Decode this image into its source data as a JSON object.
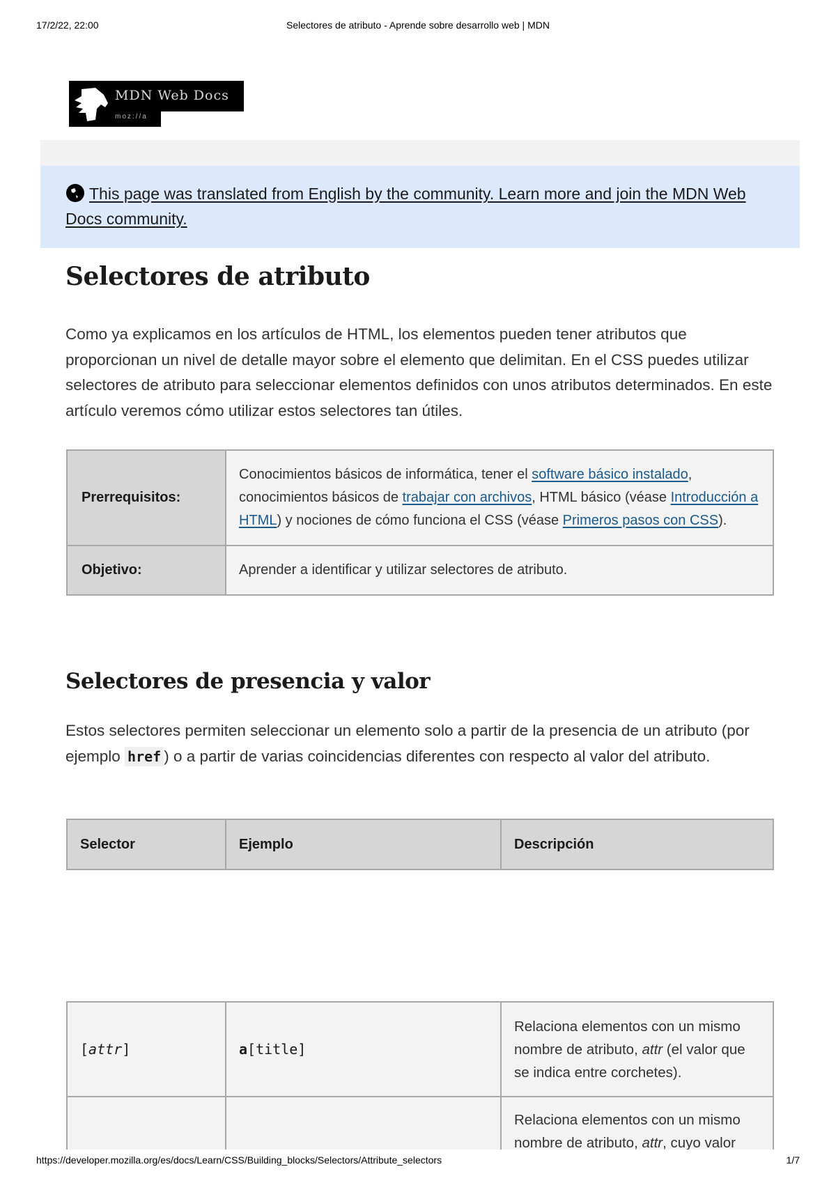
{
  "print_header": {
    "date": "17/2/22, 22:00",
    "title": "Selectores de atributo - Aprende sobre desarrollo web | MDN"
  },
  "logo": {
    "text": "MDN Web Docs",
    "sub": "moz://a",
    "icon": "dinosaur-head-icon"
  },
  "notice": {
    "icon": "globe-icon",
    "link_text": "This page was translated from English by the community. Learn more and join the MDN Web Docs community."
  },
  "article": {
    "title": "Selectores de atributo",
    "intro": "Como ya explicamos en los artículos de HTML, los elementos pueden tener atributos que proporcionan un nivel de detalle mayor sobre el elemento que delimitan. En el CSS puedes utilizar selectores de atributo para seleccionar elementos definidos con unos atributos determinados. En este artículo veremos cómo utilizar estos selectores tan útiles.",
    "info_table": {
      "prereq_label": "Prerrequisitos:",
      "prereq_parts": {
        "t1": "Conocimientos básicos de informática, tener el ",
        "l1": "software básico instalado",
        "t2": ", conocimientos básicos de ",
        "l2": "trabajar con archivos",
        "t3": ", HTML básico (véase ",
        "l3": "Introducción a HTML",
        "t4": ") y nociones de cómo funciona el CSS (véase ",
        "l4": "Primeros pasos con CSS",
        "t5": ")."
      },
      "objective_label": "Objetivo:",
      "objective_value": "Aprender a identificar y utilizar selectores de atributo."
    },
    "section": {
      "title": "Selectores de presencia y valor",
      "para_before": "Estos selectores permiten seleccionar un elemento solo a partir de la presencia de un atributo (por ejemplo ",
      "code": "href",
      "para_after": ") o a partir de varias coincidencias diferentes con respecto al valor del atributo."
    },
    "selector_table": {
      "headers": [
        "Selector",
        "Ejemplo",
        "Descripción"
      ],
      "rows": [
        {
          "selector_open": "[",
          "selector_attr": "attr",
          "selector_close": "]",
          "example_el": "a",
          "example_attr": "[title]",
          "desc_before": "Relaciona elementos con un mismo nombre de atributo, ",
          "desc_em": "attr",
          "desc_after": " (el valor que se indica entre corchetes)."
        },
        {
          "desc_before": "Relaciona elementos con un mismo nombre de atributo, ",
          "desc_em": "attr",
          "desc_after": ", cuyo valor"
        }
      ]
    }
  },
  "print_footer": {
    "url": "https://developer.mozilla.org/es/docs/Learn/CSS/Building_blocks/Selectors/Attribute_selectors",
    "page": "1/7"
  }
}
